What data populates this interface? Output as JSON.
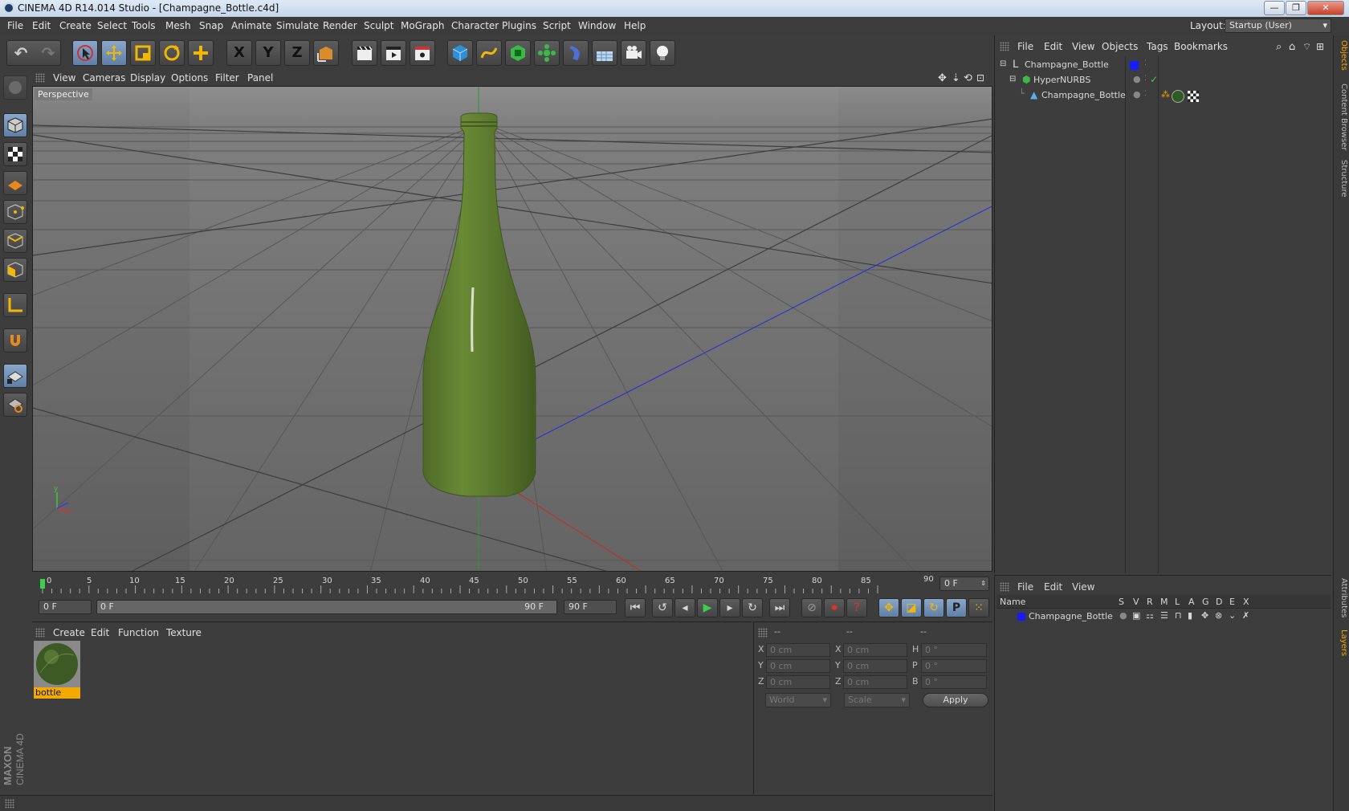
{
  "window": {
    "title": "CINEMA 4D R14.014 Studio - [Champagne_Bottle.c4d]",
    "controls": [
      "minimize",
      "restore",
      "close"
    ]
  },
  "menubar": {
    "items": [
      "File",
      "Edit",
      "Create",
      "Select",
      "Tools",
      "Mesh",
      "Snap",
      "Animate",
      "Simulate",
      "Render",
      "Sculpt",
      "MoGraph",
      "Character",
      "Plugins",
      "Script",
      "Window",
      "Help"
    ],
    "layout_label": "Layout:",
    "layout_value": "Startup (User)"
  },
  "toolbar": {
    "axis_x": "X",
    "axis_y": "Y",
    "axis_z": "Z"
  },
  "viewport": {
    "menu": [
      "View",
      "Cameras",
      "Display",
      "Options",
      "Filter",
      "Panel"
    ],
    "label": "Perspective",
    "accent_object_color": "#5d7a2f"
  },
  "timeline": {
    "ticks": [
      "0",
      "5",
      "10",
      "15",
      "20",
      "25",
      "30",
      "35",
      "40",
      "45",
      "50",
      "55",
      "60",
      "65",
      "70",
      "75",
      "80",
      "85",
      "90"
    ],
    "current_frame": "0 F"
  },
  "transport": {
    "start_field": "0 F",
    "range_start": "0 F",
    "range_end": "90 F",
    "end_field": "90 F"
  },
  "material_manager": {
    "menu": [
      "Create",
      "Edit",
      "Function",
      "Texture"
    ],
    "materials": [
      {
        "name": "bottle"
      }
    ]
  },
  "coordinates": {
    "header": [
      "--",
      "--",
      "--"
    ],
    "rows": [
      {
        "a": "X",
        "a_val": "0 cm",
        "b": "X",
        "b_val": "0 cm",
        "c": "H",
        "c_val": "0 °"
      },
      {
        "a": "Y",
        "a_val": "0 cm",
        "b": "Y",
        "b_val": "0 cm",
        "c": "P",
        "c_val": "0 °"
      },
      {
        "a": "Z",
        "a_val": "0 cm",
        "b": "Z",
        "b_val": "0 cm",
        "c": "B",
        "c_val": "0 °"
      }
    ],
    "mode": "World",
    "transform": "Scale",
    "apply_label": "Apply"
  },
  "object_manager": {
    "menu": [
      "File",
      "Edit",
      "View",
      "Objects",
      "Tags",
      "Bookmarks"
    ],
    "objects": [
      {
        "name": "Champagne_Bottle"
      },
      {
        "name": "HyperNURBS"
      },
      {
        "name": "Champagne_Bottle"
      }
    ],
    "layer_color": "#1a1aff"
  },
  "layer_manager": {
    "menu": [
      "File",
      "Edit",
      "View"
    ],
    "columns": [
      "Name",
      "S",
      "V",
      "R",
      "M",
      "L",
      "A",
      "G",
      "D",
      "E",
      "X"
    ],
    "layers": [
      {
        "name": "Champagne_Bottle"
      }
    ]
  },
  "side_tabs": [
    "Objects",
    "Content Browser",
    "Structure",
    "Attributes",
    "Layers"
  ],
  "branding": {
    "line1": "MAXON",
    "line2": "CINEMA 4D"
  }
}
